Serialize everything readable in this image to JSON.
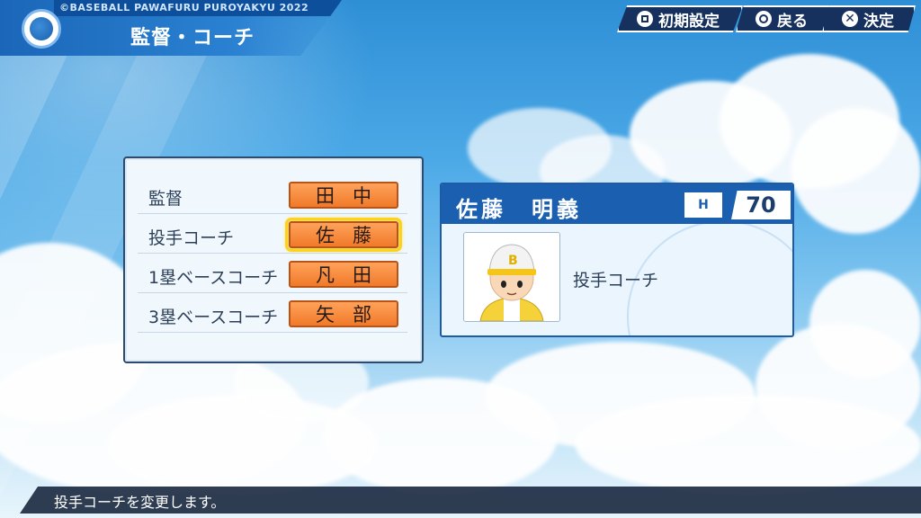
{
  "header": {
    "brand": "©BASEBALL PAWAFURU PUROYAKYU 2022",
    "title": "監督・コーチ",
    "logo_icon": "baseball-logo-icon"
  },
  "hints": [
    {
      "symbol": "square-button-icon",
      "label": "初期設定"
    },
    {
      "symbol": "circle-button-icon",
      "label": "戻る"
    },
    {
      "symbol": "cross-button-icon",
      "label": "決定"
    }
  ],
  "staff": [
    {
      "role": "監督",
      "name": "田中",
      "selected": false
    },
    {
      "role": "投手コーチ",
      "name": "佐藤",
      "selected": true
    },
    {
      "role": "1塁ベースコーチ",
      "name": "凡田",
      "selected": false
    },
    {
      "role": "3塁ベースコーチ",
      "name": "矢部",
      "selected": false
    }
  ],
  "detail": {
    "name": "佐藤　明義",
    "hand": "H",
    "rating": "70",
    "role": "投手コーチ",
    "portrait_icon": "coach-portrait-icon"
  },
  "footer": {
    "message": "投手コーチを変更します。"
  },
  "colors": {
    "sky_top": "#2f8fd6",
    "panel_header": "#1b5fb1",
    "name_button": "#f07a2a",
    "selection_glow": "#ffd21a",
    "footer_bg": "#14223a"
  }
}
